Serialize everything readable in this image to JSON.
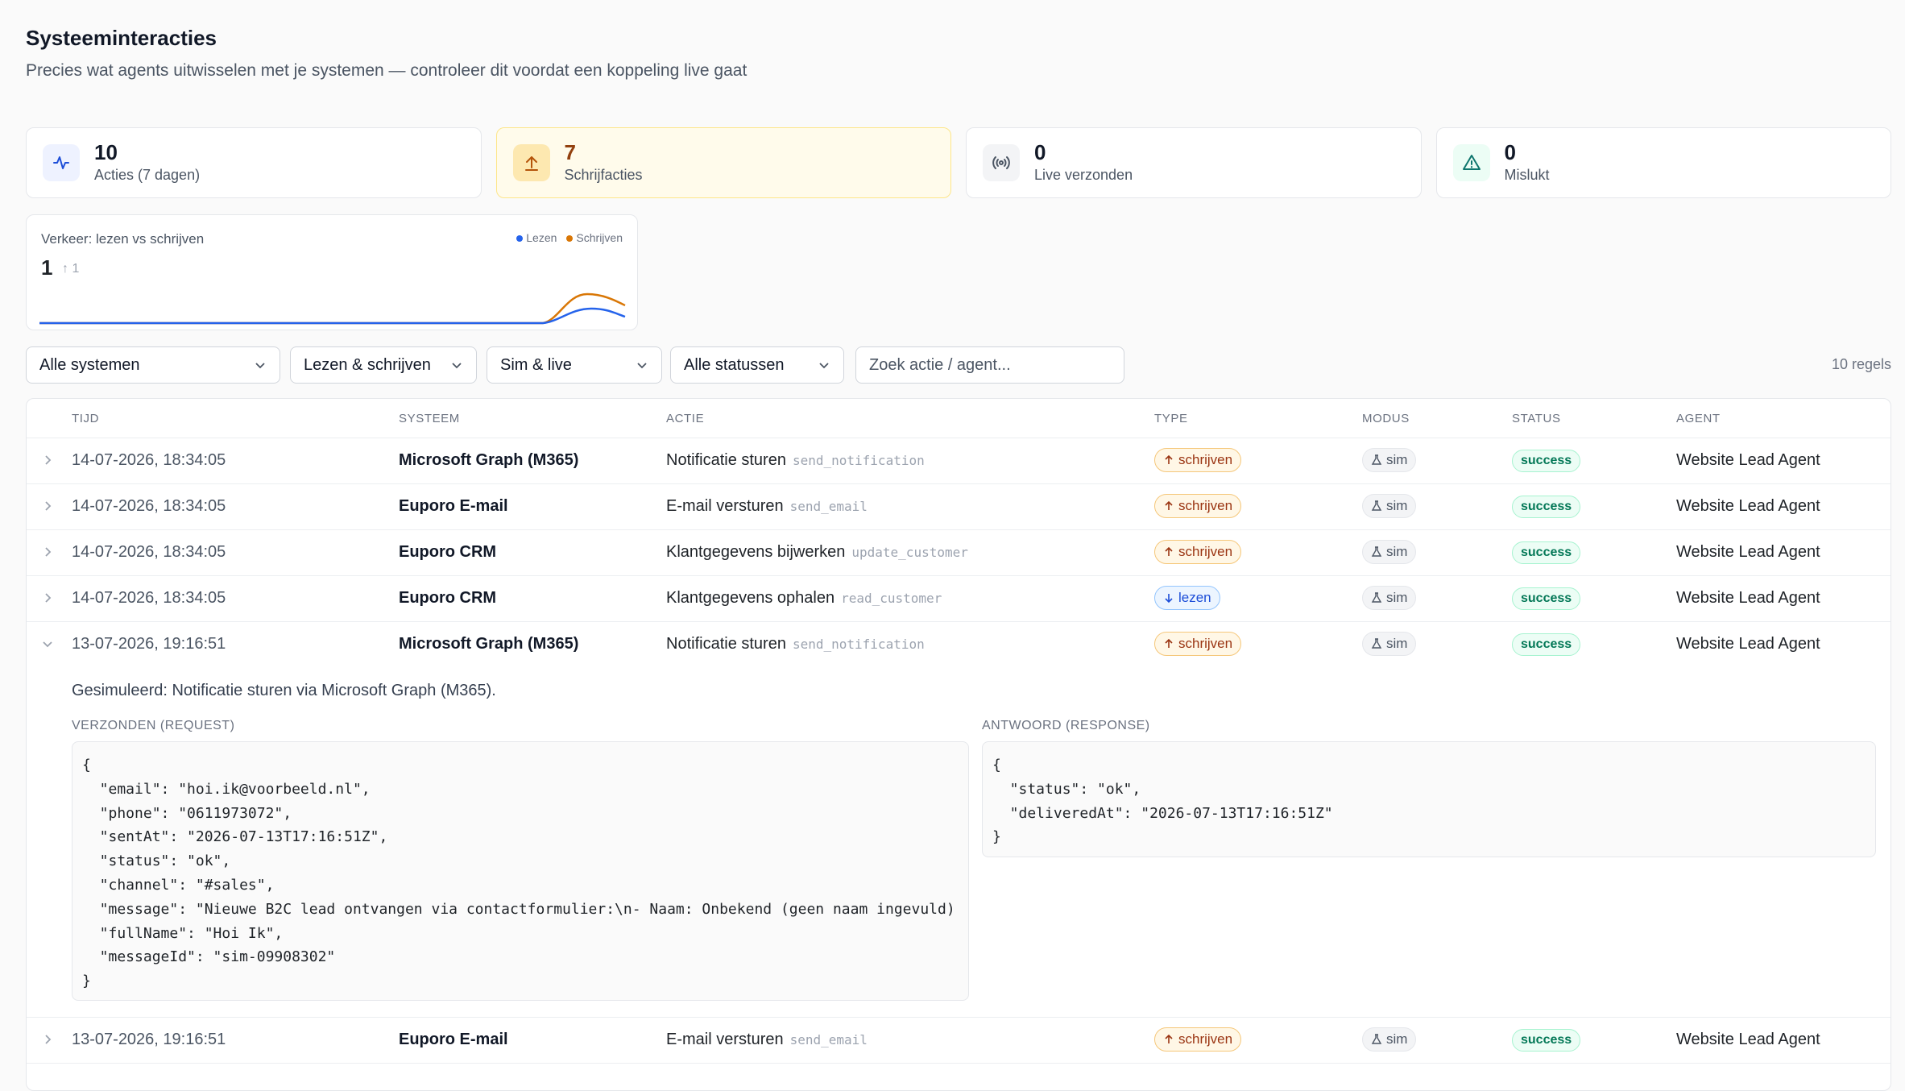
{
  "header": {
    "title": "Systeeminteracties",
    "subtitle": "Precies wat agents uitwisselen met je systemen — controleer dit voordat een koppeling live gaat"
  },
  "stats": [
    {
      "value": "10",
      "label": "Acties (7 dagen)",
      "icon": "activity-icon",
      "color": "#1d4ed8"
    },
    {
      "value": "7",
      "label": "Schrijfacties",
      "icon": "upload-icon",
      "color": "#b45309"
    },
    {
      "value": "0",
      "label": "Live verzonden",
      "icon": "broadcast-icon",
      "color": "#4b5563"
    },
    {
      "value": "0",
      "label": "Mislukt",
      "icon": "warning-icon",
      "color": "#0f766e"
    }
  ],
  "traffic": {
    "title": "Verkeer: lezen vs schrijven",
    "value": "1",
    "delta": "↑ 1",
    "legend": [
      {
        "name": "Lezen",
        "color": "#2563eb"
      },
      {
        "name": "Schrijven",
        "color": "#d97706"
      }
    ]
  },
  "filters": {
    "system": "Alle systemen",
    "type": "Lezen & schrijven",
    "mode": "Sim & live",
    "status": "Alle statussen",
    "search_placeholder": "Zoek actie / agent...",
    "row_count": "10 regels"
  },
  "table": {
    "columns": [
      "TIJD",
      "SYSTEEM",
      "ACTIE",
      "TYPE",
      "MODUS",
      "STATUS",
      "AGENT"
    ],
    "rows": [
      {
        "time": "14-07-2026, 18:34:05",
        "system": "Microsoft Graph (M365)",
        "action": "Notificatie sturen",
        "code": "send_notification",
        "type": "schrijven",
        "mode": "sim",
        "status": "success",
        "agent": "Website Lead Agent"
      },
      {
        "time": "14-07-2026, 18:34:05",
        "system": "Euporo E-mail",
        "action": "E-mail versturen",
        "code": "send_email",
        "type": "schrijven",
        "mode": "sim",
        "status": "success",
        "agent": "Website Lead Agent"
      },
      {
        "time": "14-07-2026, 18:34:05",
        "system": "Euporo CRM",
        "action": "Klantgegevens bijwerken",
        "code": "update_customer",
        "type": "schrijven",
        "mode": "sim",
        "status": "success",
        "agent": "Website Lead Agent"
      },
      {
        "time": "14-07-2026, 18:34:05",
        "system": "Euporo CRM",
        "action": "Klantgegevens ophalen",
        "code": "read_customer",
        "type": "lezen",
        "mode": "sim",
        "status": "success",
        "agent": "Website Lead Agent"
      },
      {
        "time": "13-07-2026, 19:16:51",
        "system": "Microsoft Graph (M365)",
        "action": "Notificatie sturen",
        "code": "send_notification",
        "type": "schrijven",
        "mode": "sim",
        "status": "success",
        "agent": "Website Lead Agent"
      },
      {
        "time": "13-07-2026, 19:16:51",
        "system": "Euporo E-mail",
        "action": "E-mail versturen",
        "code": "send_email",
        "type": "schrijven",
        "mode": "sim",
        "status": "success",
        "agent": "Website Lead Agent"
      }
    ],
    "expanded": {
      "message": "Gesimuleerd: Notificatie sturen via Microsoft Graph (M365).",
      "request_label": "VERZONDEN (REQUEST)",
      "response_label": "ANTWOORD (RESPONSE)",
      "request": "{\n  \"email\": \"hoi.ik@voorbeeld.nl\",\n  \"phone\": \"0611973072\",\n  \"sentAt\": \"2026-07-13T17:16:51Z\",\n  \"status\": \"ok\",\n  \"channel\": \"#sales\",\n  \"message\": \"Nieuwe B2C lead ontvangen via contactformulier:\\n- Naam: Onbekend (geen naam ingevuld)\n  \"fullName\": \"Hoi Ik\",\n  \"messageId\": \"sim-09908302\"\n}",
      "response": "{\n  \"status\": \"ok\",\n  \"deliveredAt\": \"2026-07-13T17:16:51Z\"\n}"
    }
  }
}
